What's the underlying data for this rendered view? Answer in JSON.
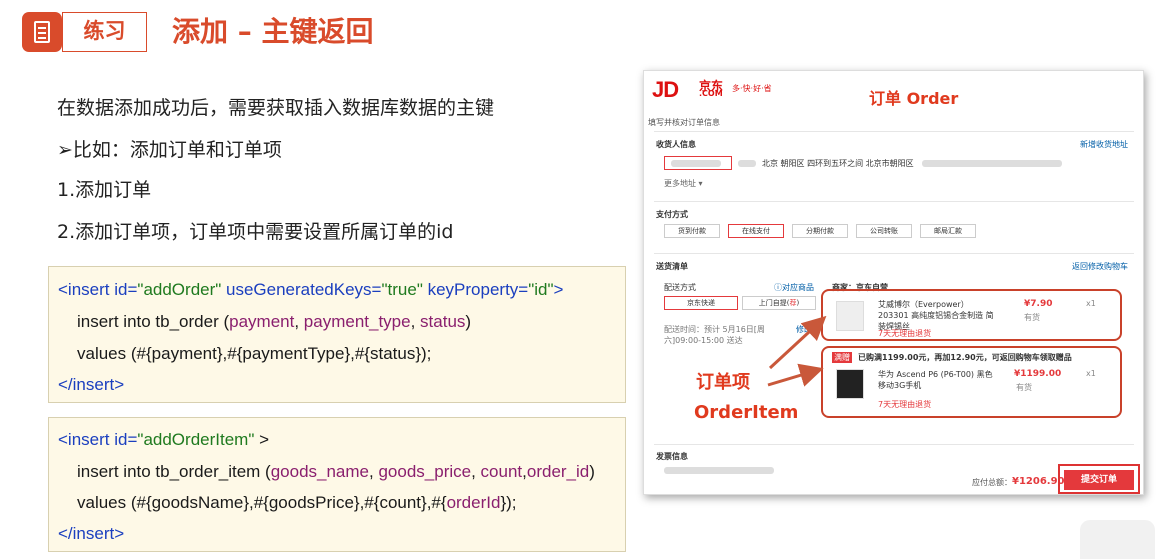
{
  "header": {
    "tag": "练习",
    "title": "添加 – 主键返回"
  },
  "lines": [
    "在数据添加成功后，需要获取插入数据库数据的主键",
    "➢比如：添加订单和订单项",
    "1.添加订单",
    "2.添加订单项，订单项中需要设置所属订单的id"
  ],
  "code1": {
    "l1": {
      "open": "<insert ",
      "id_attr": "id=",
      "id_val": "\"addOrder\"",
      "ugk_attr": " useGeneratedKeys=",
      "ugk_val": "\"true\"",
      "kp_attr": " keyProperty=",
      "kp_val": "\"id\"",
      "close": ">"
    },
    "l2": {
      "pre": "insert into tb_order (",
      "f1": "payment",
      "c1": ", ",
      "f2": "payment_type",
      "c2": ", ",
      "f3": "status",
      "post": ")"
    },
    "l3": "values (#{payment},#{paymentType},#{status});",
    "l4": "</insert>"
  },
  "code2": {
    "l1": {
      "open": "<insert ",
      "id_attr": "id=",
      "id_val": "\"addOrderItem\"",
      "close": " >"
    },
    "l2": {
      "pre": "insert into tb_order_item (",
      "f1": "goods_name",
      "c1": ", ",
      "f2": "goods_price",
      "c2": ", ",
      "f3": "count",
      "c3": ",",
      "f4": "order_id",
      "post": ")"
    },
    "l3": {
      "pre": "values (#{goodsName},#{goodsPrice},#{count},#{",
      "f": "orderId",
      "post": "});"
    },
    "l4": "</insert>"
  },
  "jd": {
    "logo": "JD",
    "logo_cn": "京东",
    "logo_com": ".COM",
    "slogan": "多·快·好·省",
    "order_label": "订单 Order",
    "fill_info": "填写并核对订单信息",
    "receiver_title": "收货人信息",
    "new_address": "新增收货地址",
    "address": "北京 朝阳区 四环到五环之间 北京市朝阳区",
    "more_address": "更多地址 ▾",
    "pay_title": "支付方式",
    "pay_options": [
      "货到付款",
      "在线支付",
      "分期付款",
      "公司转账",
      "邮局汇款"
    ],
    "delivery_title": "送货清单",
    "back_cart": "返回修改购物车",
    "ship_method": "配送方式",
    "goods_link": "ⓘ对应商品",
    "seller": "商家：京东自营",
    "ship_jd": "京东快递",
    "ship_self": "上门自提(",
    "ship_self_tag": "荐",
    "ship_self_end": ")",
    "ship_time": "配送时间：预计 5月16日[周六]09:00-15:00 送达",
    "ship_time_edit": "修改",
    "item1_name": "艾威博尔（Everpower）203301 高纯度铝锡合金制造 简装焊锡丝",
    "item1_price": "¥7.90",
    "item1_qty": "x1",
    "item1_stock": "有货",
    "item1_return": "7天无理由退货",
    "promo_tag": "满赠",
    "promo": "已购满1199.00元，再加12.90元，可返回购物车领取赠品",
    "item2_name": "华为 Ascend P6 (P6-T00) 黑色 移动3G手机",
    "item2_price": "¥1199.00",
    "item2_qty": "x1",
    "item2_stock": "有货",
    "item2_return": "7天无理由退货",
    "orderitem_cn": "订单项",
    "orderitem_en": "OrderItem",
    "invoice_title": "发票信息",
    "total_label": "应付总额：",
    "total_value": "¥1206.90",
    "submit": "提交订单"
  }
}
